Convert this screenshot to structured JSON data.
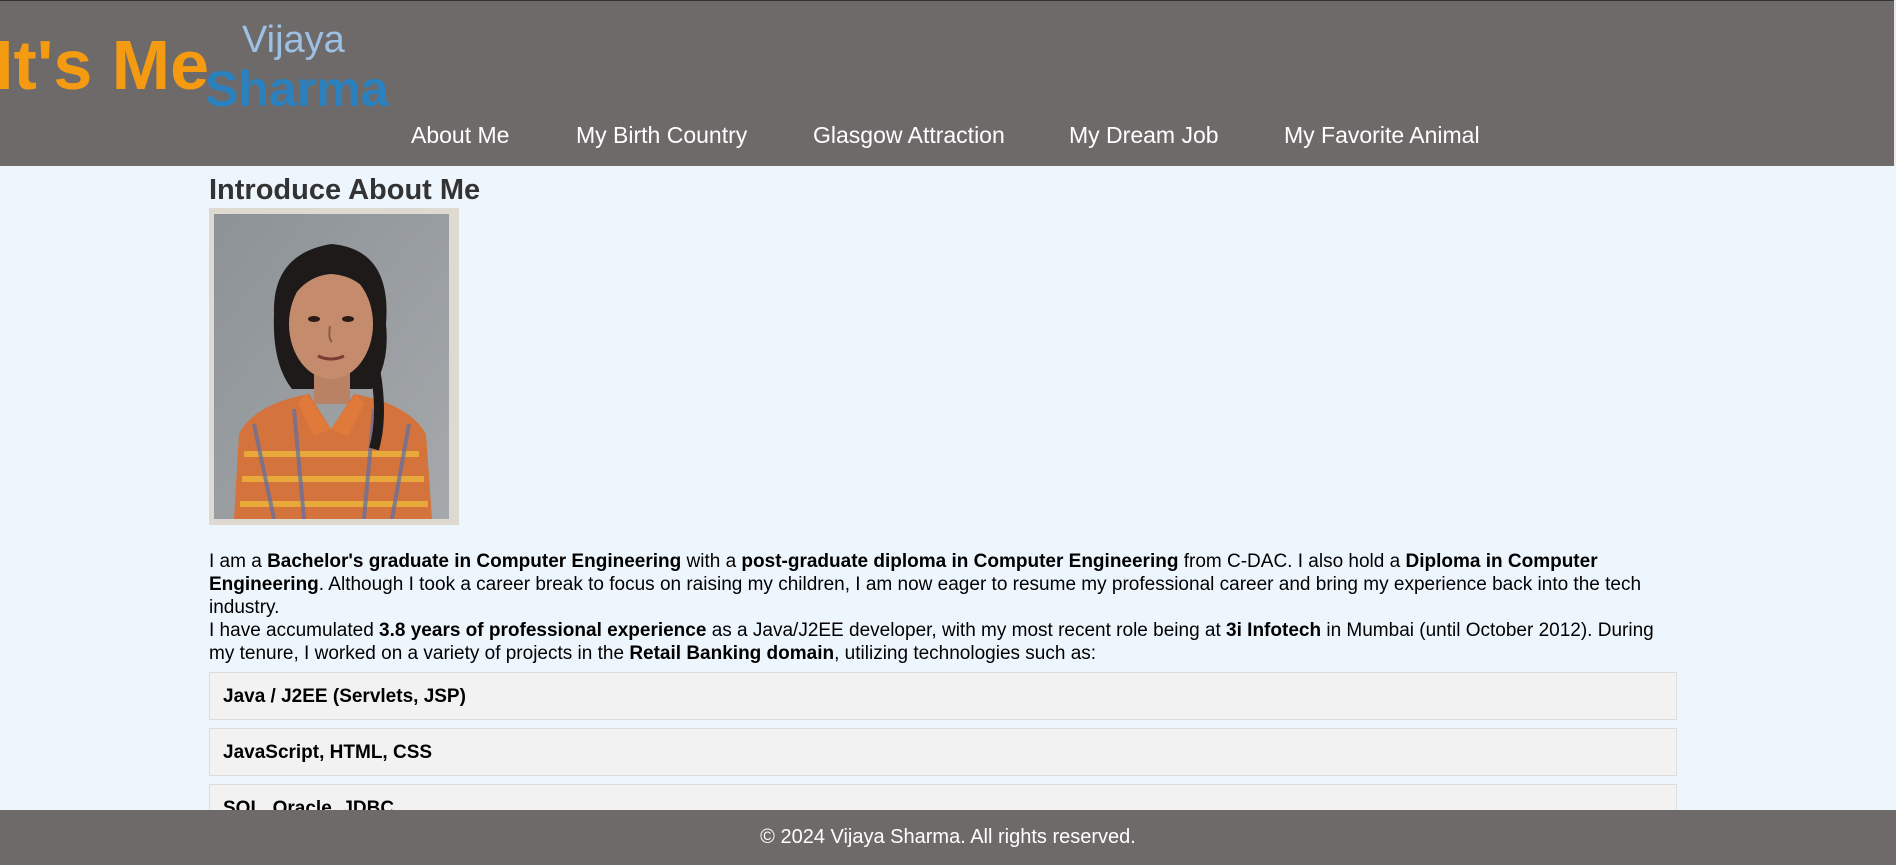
{
  "header": {
    "logo_left": "It's Me",
    "logo_first": "Vijaya",
    "logo_last": "Sharma",
    "nav": [
      {
        "label": "About Me"
      },
      {
        "label": "My Birth Country"
      },
      {
        "label": "Glasgow Attraction"
      },
      {
        "label": "My Dream Job"
      },
      {
        "label": "My Favorite Animal"
      }
    ]
  },
  "main": {
    "heading": "Introduce About Me",
    "bio": {
      "p1": [
        {
          "t": "I am a ",
          "b": false
        },
        {
          "t": "Bachelor's graduate in Computer Engineering",
          "b": true
        },
        {
          "t": " with a ",
          "b": false
        },
        {
          "t": "post-graduate diploma in Computer Engineering",
          "b": true
        },
        {
          "t": " from C-DAC. I also hold a ",
          "b": false
        },
        {
          "t": "Diploma in Computer Engineering",
          "b": true
        },
        {
          "t": ". Although I took a career break to focus on raising my children, I am now eager to resume my professional career and bring my experience back into the tech industry.",
          "b": false
        }
      ],
      "p2": [
        {
          "t": "I have accumulated ",
          "b": false
        },
        {
          "t": "3.8 years of professional experience",
          "b": true
        },
        {
          "t": " as a Java/J2EE developer, with my most recent role being at ",
          "b": false
        },
        {
          "t": "3i Infotech",
          "b": true
        },
        {
          "t": " in Mumbai (until October 2012). During my tenure, I worked on a variety of projects in the ",
          "b": false
        },
        {
          "t": "Retail Banking domain",
          "b": true
        },
        {
          "t": ", utilizing technologies such as:",
          "b": false
        }
      ]
    },
    "skills": [
      "Java / J2EE (Servlets, JSP)",
      "JavaScript, HTML, CSS",
      "SQL, Oracle, JDBC"
    ]
  },
  "footer": {
    "text": "© 2024 Vijaya Sharma. All rights reserved."
  },
  "colors": {
    "header_bg": "#6f6a6a",
    "page_bg": "#eef6fd",
    "logo_orange": "#f49b12",
    "logo_light_blue": "#9cc1e4",
    "logo_blue": "#2b80be"
  }
}
